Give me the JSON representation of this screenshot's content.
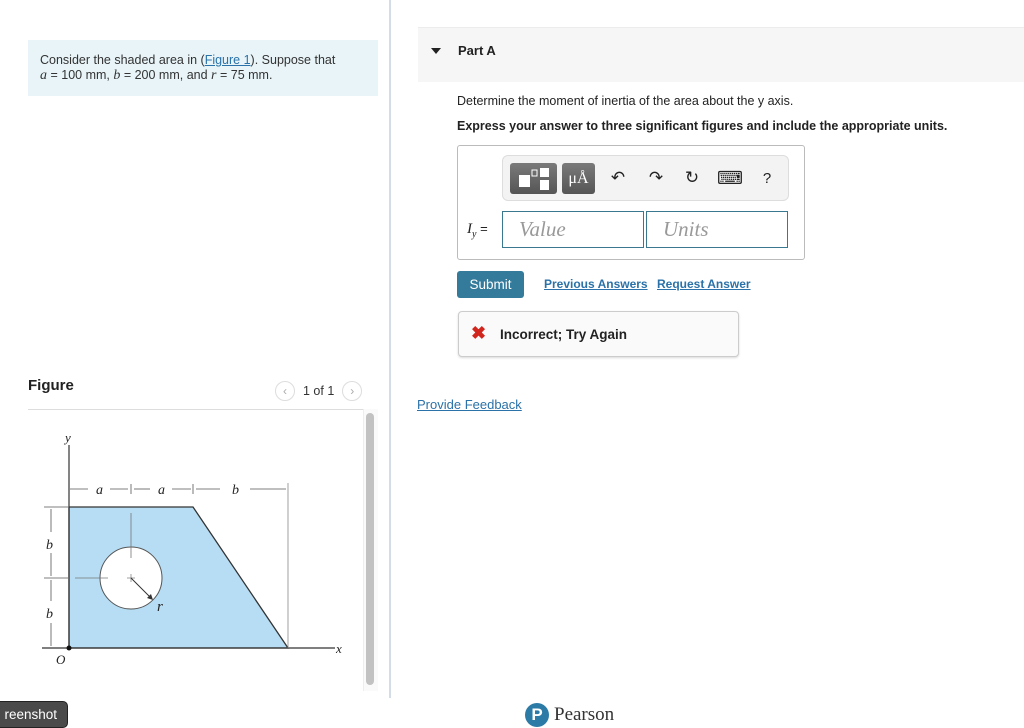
{
  "problem": {
    "intro": "Consider the shaded area in (",
    "figure_link": "Figure 1",
    "intro_end": "). Suppose that",
    "a_var": "a",
    "a_val": " = 100 mm",
    "b_var": "b",
    "b_val": " = 200 mm",
    "and": ", and ",
    "r_var": "r",
    "r_val": " = 75 mm",
    "sep": ", ",
    "period": "."
  },
  "figure": {
    "title": "Figure",
    "pager": "1 of 1",
    "prev_icon": "‹",
    "next_icon": "›",
    "labels": {
      "y": "y",
      "x": "x",
      "origin": "O",
      "a1": "a",
      "a2": "a",
      "b_top": "b",
      "b_left1": "b",
      "b_left2": "b",
      "r": "r"
    },
    "fill_color": "#b6ddf3"
  },
  "part": {
    "title": "Part A",
    "question": "Determine the moment of inertia of the area about the y axis.",
    "instruction": "Express your answer to three significant figures and include the appropriate units."
  },
  "answer": {
    "label_var": "I",
    "label_sub": "y",
    "label_eq": " =",
    "value_placeholder": "Value",
    "units_placeholder": "Units",
    "toolbar": {
      "templates_icon": "templates-icon",
      "units_symbol": "μÅ",
      "undo": "↶",
      "redo": "↷",
      "reset": "↻",
      "keyboard": "⌨",
      "help": "?"
    }
  },
  "actions": {
    "submit": "Submit",
    "previous_answers": "Previous Answers",
    "request_answer": "Request Answer"
  },
  "feedback": {
    "icon": "✖",
    "message": "Incorrect; Try Again"
  },
  "provide_feedback": "Provide Feedback",
  "screenshot_button": "reenshot",
  "footer": {
    "logo_letter": "P",
    "brand": "Pearson"
  },
  "colors": {
    "accent": "#337a9b",
    "link": "#2a72a8",
    "error": "#d0261e",
    "problem_bg": "#e8f4f8"
  }
}
